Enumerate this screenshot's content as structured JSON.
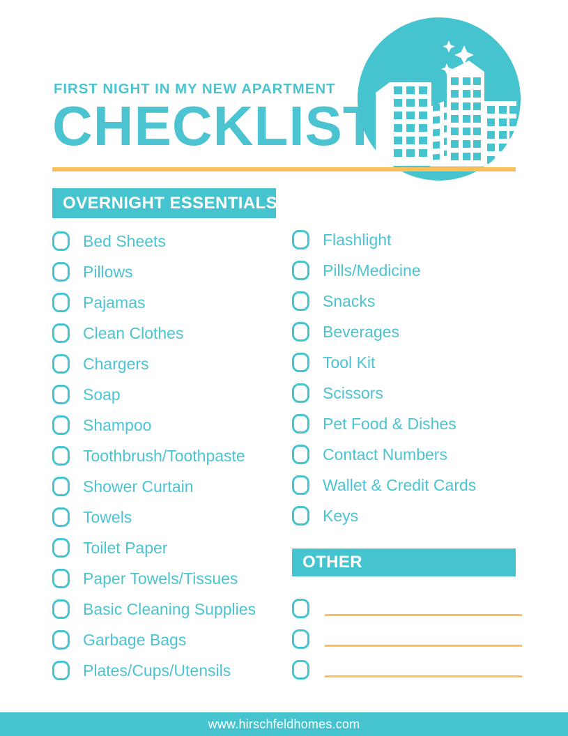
{
  "header": {
    "kicker": "FIRST NIGHT IN MY NEW APARTMENT",
    "headline": "CHECKLIST",
    "logo_icon": "night-city-skyline-icon"
  },
  "colors": {
    "teal": "#45c3ce",
    "teal_text": "#4cc3d0",
    "amber": "#fbc05a",
    "white": "#ffffff"
  },
  "sections": {
    "essentials": {
      "label": "OVERNIGHT ESSENTIALS",
      "left_items": [
        "Bed Sheets",
        "Pillows",
        "Pajamas",
        "Clean Clothes",
        "Chargers",
        "Soap",
        "Shampoo",
        "Toothbrush/Toothpaste",
        "Shower Curtain",
        "Towels",
        "Toilet Paper",
        "Paper Towels/Tissues",
        "Basic Cleaning Supplies",
        "Garbage Bags",
        "Plates/Cups/Utensils"
      ],
      "right_items": [
        "Flashlight",
        "Pills/Medicine",
        "Snacks",
        "Beverages",
        "Tool Kit",
        "Scissors",
        "Pet Food & Dishes",
        "Contact Numbers",
        "Wallet & Credit Cards",
        "Keys"
      ]
    },
    "other": {
      "label": "OTHER",
      "blank_lines": [
        "",
        "",
        ""
      ]
    }
  },
  "footer": {
    "url": "www.hirschfeldhomes.com"
  }
}
